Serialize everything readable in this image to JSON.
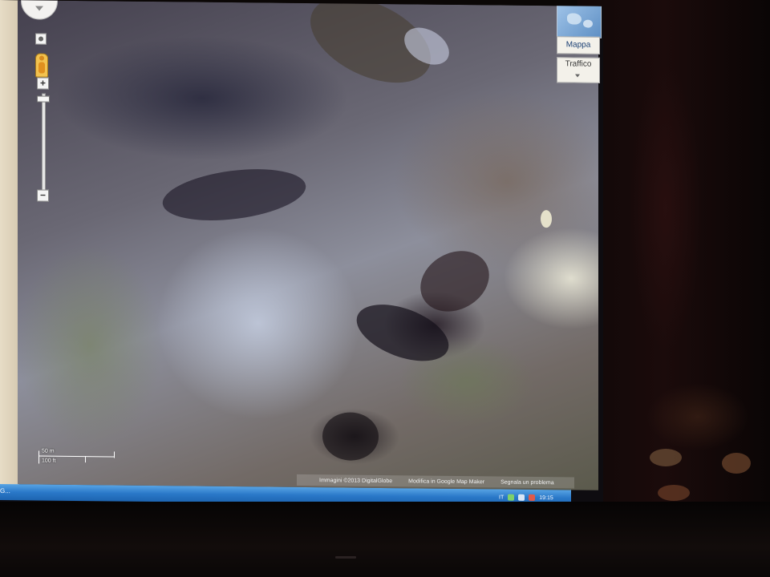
{
  "map": {
    "view": "satellite",
    "controls": {
      "zoom_in_label": "+",
      "zoom_out_label": "−",
      "zoom_level_fraction": 0.03
    },
    "map_type": {
      "map_label": "Mappa",
      "traffic_label": "Traffico"
    },
    "scale": {
      "metric_label": "50 m",
      "imperial_label": "100 ft"
    },
    "attribution": {
      "imagery": "Immagini ©2013 DigitalGlobe",
      "edit_link": "Modifica in Google Map Maker",
      "report_link": "Segnala un problema"
    }
  },
  "taskbar": {
    "left_item": "G...",
    "tray_language": "IT",
    "clock": "19:15"
  },
  "colors": {
    "taskbar": "#2a78c8",
    "map_type_text": "#1a3f73"
  }
}
